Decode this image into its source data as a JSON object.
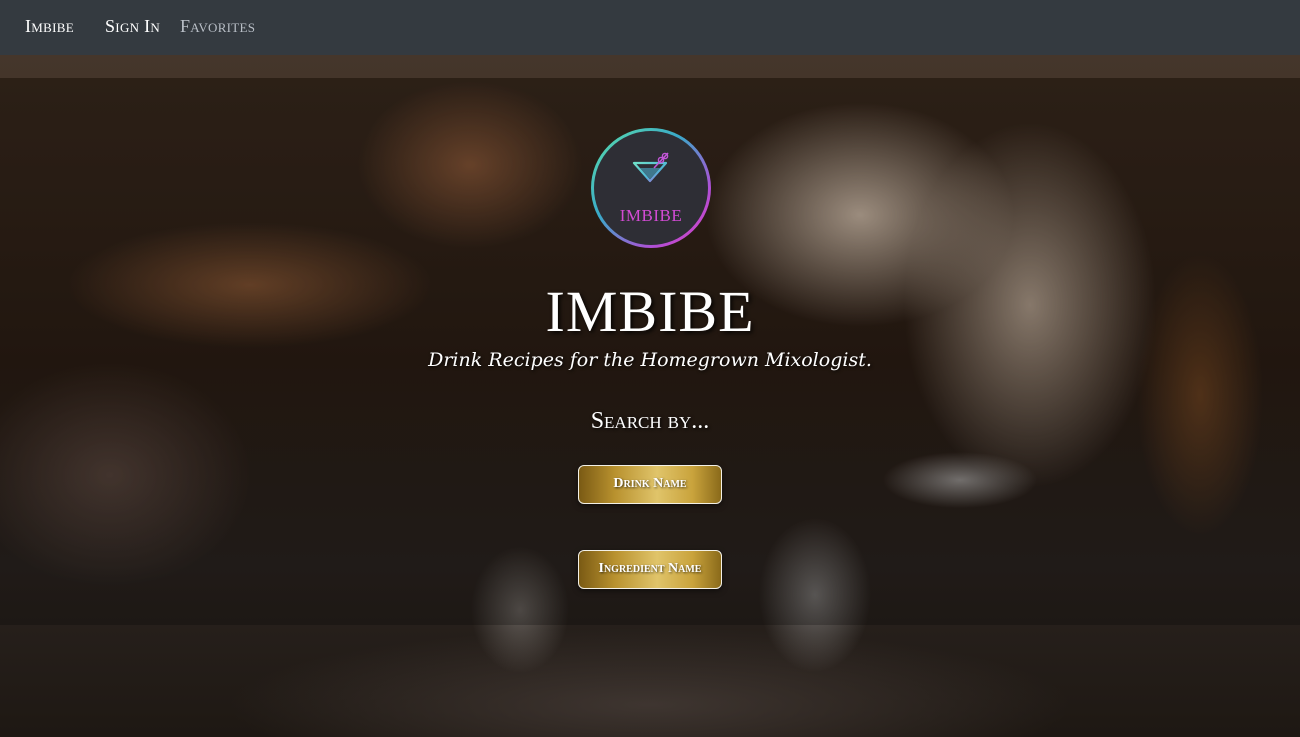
{
  "navbar": {
    "brand": "Imbibe",
    "sign_in": "Sign In",
    "favorites": "Favorites"
  },
  "logo": {
    "text": "IMBIBE",
    "icon": "martini-glass-icon"
  },
  "hero": {
    "title": "IMBIBE",
    "subtitle": "Drink Recipes for the Homegrown Mixologist.",
    "search_label": "Search by..."
  },
  "buttons": {
    "drink_name": "Drink Name",
    "ingredient_name": "Ingredient Name"
  },
  "colors": {
    "navbar_bg": "#343a40",
    "logo_text": "#d24bd4",
    "button_gold": "#c9a33c"
  }
}
